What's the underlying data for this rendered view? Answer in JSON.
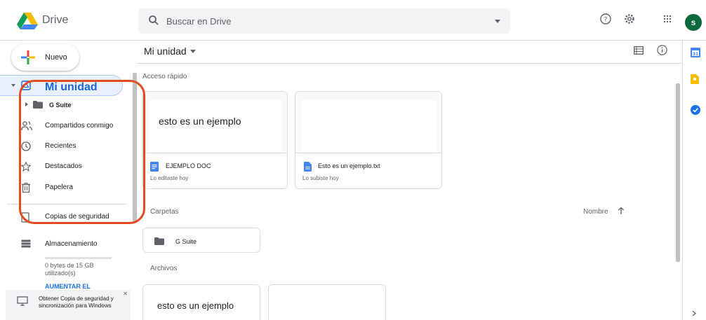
{
  "header": {
    "app_name": "Drive",
    "search_placeholder": "Buscar en Drive",
    "avatar_letter": "s"
  },
  "sidebar": {
    "new_label": "Nuevo",
    "items": [
      {
        "label": "Mi unidad",
        "icon": "my-drive-icon",
        "active": true
      },
      {
        "label": "G Suite",
        "icon": "folder-icon"
      },
      {
        "label": "Compartidos conmigo",
        "icon": "shared-icon"
      },
      {
        "label": "Recientes",
        "icon": "clock-icon"
      },
      {
        "label": "Destacados",
        "icon": "star-icon"
      },
      {
        "label": "Papelera",
        "icon": "trash-icon"
      },
      {
        "label": "Copias de seguridad",
        "icon": "backup-icon"
      },
      {
        "label": "Almacenamiento",
        "icon": "storage-icon"
      }
    ],
    "storage_text": "0 bytes de 15 GB utilizado(s)",
    "upgrade_label": "AUMENTAR EL",
    "backup_banner": "Obtener Copia de seguridad y sincronización para Windows"
  },
  "main": {
    "title": "Mi unidad",
    "quick_access_label": "Acceso rápido",
    "quick_access": [
      {
        "preview": "esto es un ejemplo",
        "name": "EJEMPLO DOC",
        "subtitle": "Lo editaste hoy",
        "icon": "doc-icon"
      },
      {
        "preview": "",
        "name": "Esto es un ejemplo.txt",
        "subtitle": "Lo subiste hoy",
        "icon": "file-icon"
      }
    ],
    "folders_label": "Carpetas",
    "sort_label": "Nombre",
    "folders": [
      {
        "name": "G Suite"
      }
    ],
    "files_label": "Archivos",
    "files": [
      {
        "preview": "esto es un ejemplo"
      },
      {
        "preview": ""
      }
    ]
  },
  "colors": {
    "accent": "#1a73e8",
    "active_bg": "#e8f0fe",
    "annotation": "#e34b25"
  }
}
